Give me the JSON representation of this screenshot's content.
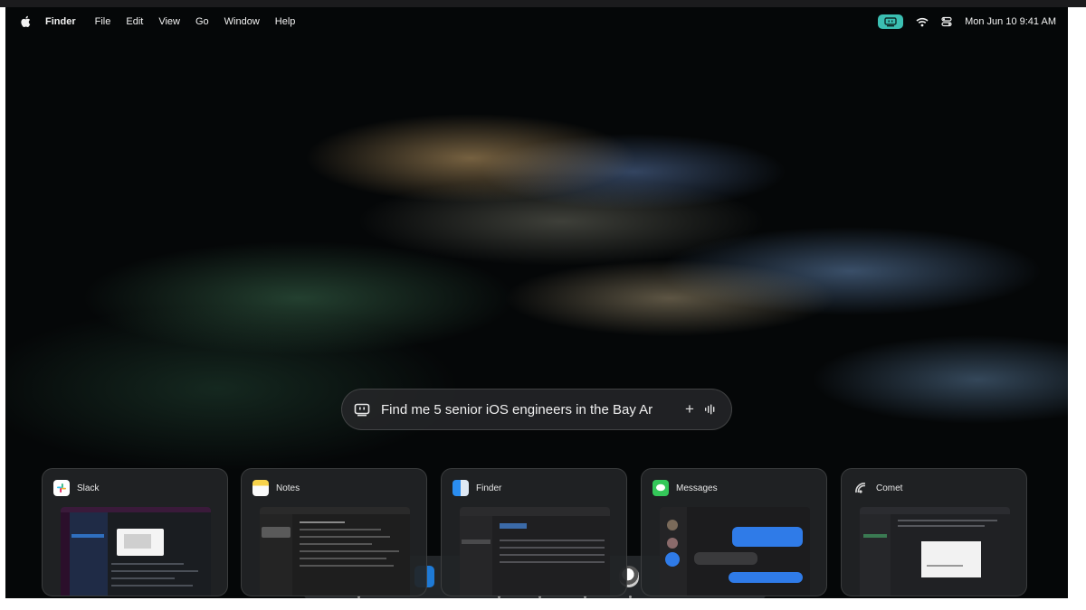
{
  "menubar": {
    "apple_icon": "apple-logo-icon",
    "items": [
      "Finder",
      "File",
      "Edit",
      "View",
      "Go",
      "Window",
      "Help"
    ],
    "status_icons": [
      "screen-agent-icon",
      "wifi-icon",
      "control-center-icon"
    ],
    "clock": "Mon Jun 10  9:41 AM",
    "accent_color": "#3bbfb2"
  },
  "prompt": {
    "value": "Find me 5 senior iOS engineers in the Bay Ar",
    "left_icon": "screen-agent-icon",
    "add_icon": "plus-icon",
    "voice_icon": "waveform-icon"
  },
  "cards": [
    {
      "app": "Slack",
      "icon": "slack-icon"
    },
    {
      "app": "Notes",
      "icon": "notes-icon"
    },
    {
      "app": "Finder",
      "icon": "finder-icon"
    },
    {
      "app": "Messages",
      "icon": "messages-icon"
    },
    {
      "app": "Comet",
      "icon": "comet-icon"
    }
  ]
}
